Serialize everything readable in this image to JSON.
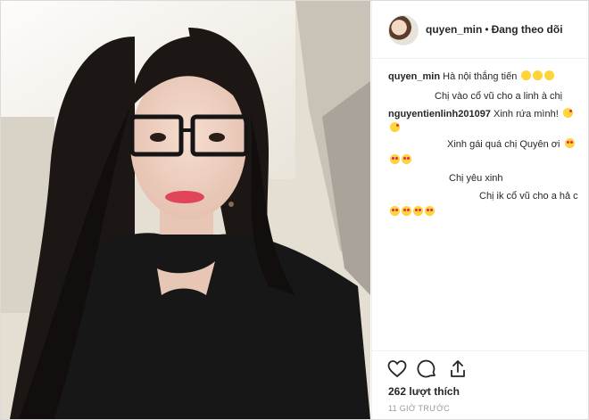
{
  "post": {
    "author": "quyen_min",
    "separator": "•",
    "follow_status": "Đang theo dõi",
    "likes": "262 lượt thích",
    "time": "11 GIỜ TRƯỚC"
  },
  "comments": [
    {
      "user": "quyen_min",
      "text": "Hà nội thắng tiến"
    },
    {
      "user": "",
      "text": "Chị vào cổ vũ cho a linh à chị"
    },
    {
      "user": "nguyentienlinh201097",
      "text": "Xinh rứa mình!"
    },
    {
      "user": "",
      "text": "Xinh gái quá chị Quyên ơi"
    },
    {
      "user": "",
      "text": "Chị yêu xinh"
    },
    {
      "user": "",
      "text": "Chị ik cổ vũ cho a hả c"
    }
  ],
  "icons": {
    "like": "heart-icon",
    "comment": "comment-icon",
    "share": "share-icon",
    "emoji_laugh": "laughing-emoji-icon",
    "emoji_heart_eyes": "heart-eyes-emoji-icon",
    "emoji_kiss": "kiss-emoji-icon"
  },
  "colors": {
    "text": "#262626",
    "muted": "#999999",
    "border": "#efefef"
  }
}
